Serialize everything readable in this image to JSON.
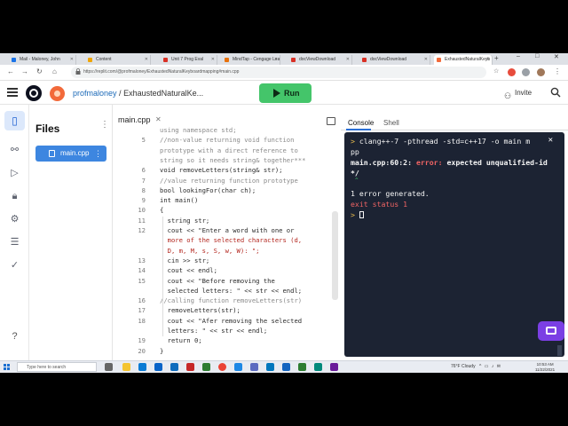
{
  "browser": {
    "tabs": [
      {
        "label": "Mail - Maloney, John",
        "color": "#1a73e8"
      },
      {
        "label": "Content",
        "color": "#f0a500"
      },
      {
        "label": "Unit 7 Prog Eval",
        "color": "#d93025"
      },
      {
        "label": "MindTap - Cengage Lea",
        "color": "#e8710a"
      },
      {
        "label": "docViewDownload",
        "color": "#d93025"
      },
      {
        "label": "docViewDownload",
        "color": "#d93025"
      },
      {
        "label": "ExhaustedNaturalKeyb",
        "color": "#f26a3a",
        "active": true
      }
    ],
    "url": "https://replit.com/@profmaloney/ExhaustedNaturalKeyboardmapping#main.cpp"
  },
  "header": {
    "username": "profmaloney",
    "separator": "/",
    "repl_name": "ExhaustedNaturalKe...",
    "run_label": "Run",
    "invite_label": "Invite"
  },
  "files": {
    "title": "Files",
    "menu": "⋮",
    "items": [
      {
        "name": "main.cpp"
      }
    ]
  },
  "editor": {
    "tab_label": "main.cpp",
    "lines": [
      {
        "n": "",
        "text": "using namespace std;",
        "cls": "c-com"
      },
      {
        "n": "5",
        "text": "//non-value returning void function",
        "cls": "c-com"
      },
      {
        "n": "",
        "text": "prototype with a direct reference to",
        "cls": "c-com"
      },
      {
        "n": "",
        "text": "string so it needs string& together***",
        "cls": "c-com"
      },
      {
        "n": "6",
        "text": "void removeLetters(string& str);",
        "cls": ""
      },
      {
        "n": "7",
        "text": "//value returning function prototype",
        "cls": "c-com"
      },
      {
        "n": "8",
        "text": "bool lookingFor(char ch);",
        "cls": ""
      },
      {
        "n": "9",
        "text": "int main()",
        "cls": ""
      },
      {
        "n": "10",
        "text": "{",
        "cls": ""
      },
      {
        "n": "11",
        "text": "  string str;",
        "cls": ""
      },
      {
        "n": "12",
        "text": "  cout << \"Enter a word with one or",
        "cls": ""
      },
      {
        "n": "",
        "text": "  more of the selected characters (d,",
        "cls": "c-str"
      },
      {
        "n": "",
        "text": "  D, m, M, s, S, w, W): \";",
        "cls": "c-str"
      },
      {
        "n": "13",
        "text": "  cin >> str;",
        "cls": ""
      },
      {
        "n": "14",
        "text": "  cout << endl;",
        "cls": ""
      },
      {
        "n": "15",
        "text": "  cout << \"Before removing the",
        "cls": ""
      },
      {
        "n": "",
        "text": "  selected letters: \" << str << endl;",
        "cls": ""
      },
      {
        "n": "16",
        "text": "//calling function removeLetters(str)",
        "cls": "c-com"
      },
      {
        "n": "17",
        "text": "  removeLetters(str);",
        "cls": ""
      },
      {
        "n": "18",
        "text": "  cout << \"Afer removing the selected",
        "cls": ""
      },
      {
        "n": "",
        "text": "  letters: \" << str << endl;",
        "cls": ""
      },
      {
        "n": "19",
        "text": "  return 0;",
        "cls": ""
      },
      {
        "n": "20",
        "text": "}",
        "cls": ""
      }
    ]
  },
  "console": {
    "tab_console": "Console",
    "tab_shell": "Shell",
    "prompt": ">",
    "command": "clang++-7 -pthread -std=c++17 -o main m",
    "command_wrap": "pp",
    "error_location": "main.cpp:60:2:",
    "error_label": "error:",
    "error_message": "expected unqualified-id",
    "error_wrap": "*/",
    "caret": "^",
    "summary": "1 error generated.",
    "exit_status": "exit status 1",
    "close": "✕"
  },
  "taskbar": {
    "search_placeholder": "Type here to search",
    "weather": "76°F Cloudy",
    "time": "10:53 AM",
    "date": "11/22/2021"
  }
}
